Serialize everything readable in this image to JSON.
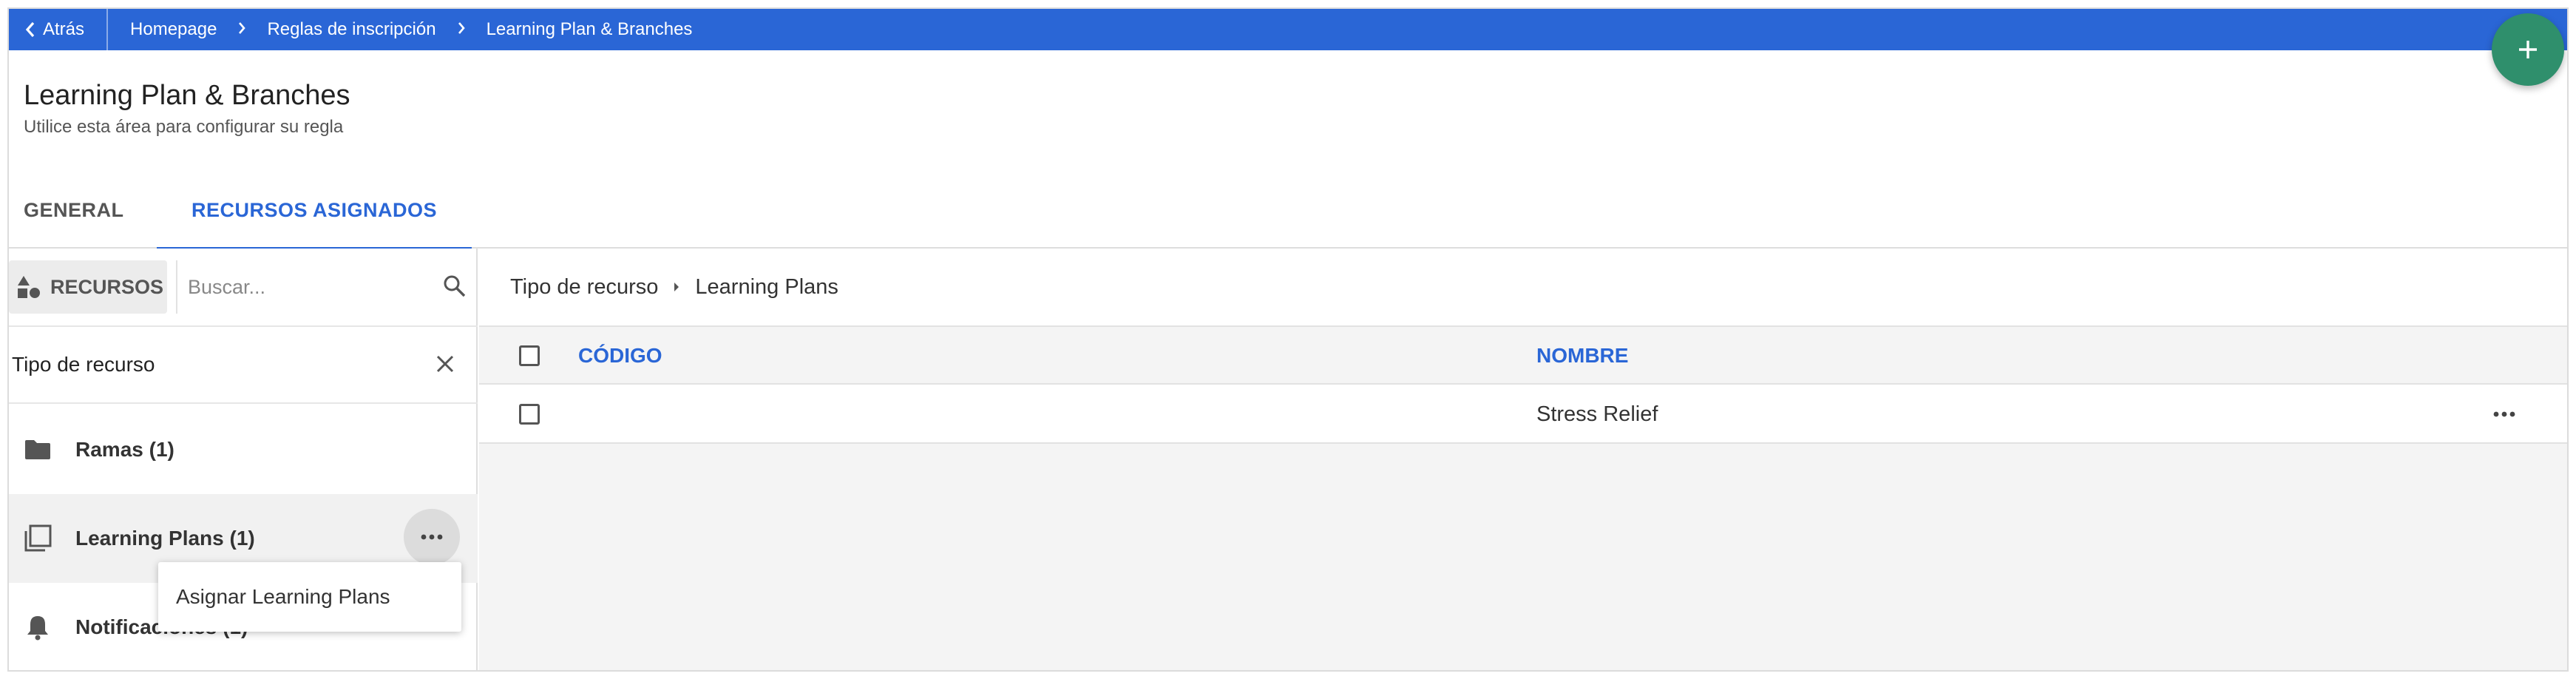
{
  "topbar": {
    "back_label": "Atrás",
    "breadcrumbs": [
      "Homepage",
      "Reglas de inscripción",
      "Learning Plan & Branches"
    ],
    "background": "#2a66d6"
  },
  "fab": {
    "icon": "plus-icon",
    "color": "#2f8f6c"
  },
  "header": {
    "title": "Learning Plan & Branches",
    "subtitle": "Utilice esta área para configurar su regla"
  },
  "tabs": [
    {
      "label": "GENERAL",
      "active": false
    },
    {
      "label": "RECURSOS ASIGNADOS",
      "active": true
    }
  ],
  "sidebar": {
    "resources_button": "RECURSOS",
    "search_placeholder": "Buscar...",
    "filter_title": "Tipo de recurso",
    "items": [
      {
        "label": "Ramas (1)",
        "icon": "folder-icon"
      },
      {
        "label": "Learning Plans (1)",
        "icon": "learning-plan-icon",
        "selected": true
      },
      {
        "label": "Notificaciones (1)",
        "icon": "bell-icon"
      }
    ],
    "context_menu": {
      "item": "Asignar Learning Plans"
    }
  },
  "main": {
    "breadcrumb": [
      "Tipo de recurso",
      "Learning Plans"
    ],
    "columns": [
      "CÓDIGO",
      "NOMBRE"
    ],
    "rows": [
      {
        "code": "",
        "name": "Stress Relief"
      }
    ]
  },
  "colors": {
    "accent": "#2a66d6",
    "fab": "#2f8f6c"
  }
}
